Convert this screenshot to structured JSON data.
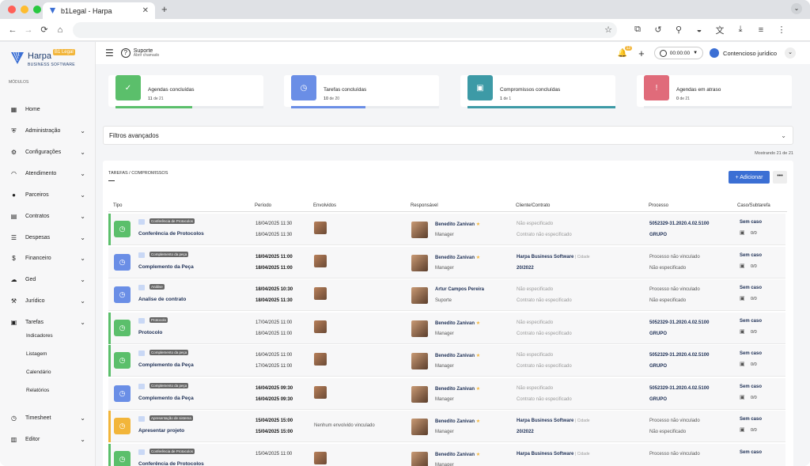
{
  "browser": {
    "tab_title": "b1Legal - Harpa",
    "tab_close": "✕",
    "new_tab": "+",
    "nav_back": "←",
    "nav_forward": "→",
    "nav_reload": "⟳",
    "nav_home": "⌂",
    "bookmark": "☆",
    "menu": "⋮"
  },
  "app": {
    "logo_name": "Harpa",
    "logo_badge": "B1 Legal",
    "logo_tagline": "BUSINESS SOFTWARE",
    "modules_label": "MÓDULOS"
  },
  "sidebar": {
    "items": [
      {
        "label": "Home",
        "icon": "grid-icon",
        "chev": ""
      },
      {
        "label": "Administração",
        "icon": "shield-icon",
        "chev": "⌄"
      },
      {
        "label": "Configurações",
        "icon": "gear-icon",
        "chev": "⌄"
      },
      {
        "label": "Atendimento",
        "icon": "headset-icon",
        "chev": "⌄"
      },
      {
        "label": "Parceiros",
        "icon": "user-icon",
        "chev": "⌄"
      },
      {
        "label": "Contratos",
        "icon": "document-icon",
        "chev": "⌄"
      },
      {
        "label": "Despesas",
        "icon": "list-icon",
        "chev": "⌄"
      },
      {
        "label": "Financeiro",
        "icon": "dollar-icon",
        "chev": "⌄"
      },
      {
        "label": "Ged",
        "icon": "cloud-icon",
        "chev": "⌄"
      },
      {
        "label": "Jurídico",
        "icon": "gavel-icon",
        "chev": "⌄"
      },
      {
        "label": "Tarefas",
        "icon": "calendar-icon",
        "chev": "⌄"
      },
      {
        "label": "Timesheet",
        "icon": "clock-icon",
        "chev": "⌄"
      },
      {
        "label": "Editor",
        "icon": "file-icon",
        "chev": "⌄"
      }
    ],
    "subitems": [
      "Indicadores",
      "Listagem",
      "Calendário",
      "Relatórios"
    ]
  },
  "header": {
    "support_title": "Suporte",
    "support_sub": "Abrir chamado",
    "notif_count": "12",
    "timer": "00:00:00",
    "user": "Contencioso jurídico"
  },
  "cards": [
    {
      "title": "Agendas concluídas",
      "done": "11",
      "of": "de 21",
      "color": "#5bbf6b",
      "fill": 0.52
    },
    {
      "title": "Tarefas concluídas",
      "done": "10",
      "of": "de 20",
      "color": "#6a8ee6",
      "fill": 0.5
    },
    {
      "title": "Compromissos concluídas",
      "done": "1",
      "of": "de 1",
      "color": "#3d9aa6",
      "fill": 1.0
    },
    {
      "title": "Agendas em atraso",
      "done": "0",
      "of": "de 21",
      "color": "#e06b7a",
      "fill": 0.0
    }
  ],
  "filters": {
    "label": "Filtros avançados"
  },
  "showing": "Mostrando 21 de 21",
  "table": {
    "title": "TAREFAS / COMPROMISSOS",
    "add_label": "+  Adicionar",
    "more_label": "•••",
    "columns": [
      "Tipo",
      "Período",
      "Envolvidos",
      "Responsável",
      "Cliente/Contrato",
      "Processo",
      "Caso/Subtarefa"
    ],
    "rows": [
      {
        "stripe": "#5bbf6b",
        "icon_color": "#5bbf6b",
        "tag": "Conferência de Protocolos",
        "title": "Conferência de Protocolos",
        "p1": "18/04/2025 11:30",
        "p2": "18/04/2025 11:30",
        "pbold": false,
        "env": "avatar",
        "resp": "Benedito Zanivan",
        "star": true,
        "role": "Manager",
        "c1": "Não especificado",
        "c2": "Contrato não especificado",
        "cstyle": "m",
        "c1sub": "",
        "pr1": "5052329-31.2020.4.02.5100",
        "pr2": "GRUPO",
        "prstyle": "s",
        "case": "Sem caso",
        "count": "0/0"
      },
      {
        "stripe": "",
        "icon_color": "#6a8ee6",
        "tag": "Complemento da peça",
        "title": "Complemento da Peça",
        "p1": "18/04/2025 11:00",
        "p2": "18/04/2025 11:00",
        "pbold": true,
        "env": "avatar",
        "resp": "Benedito Zanivan",
        "star": true,
        "role": "Manager",
        "c1": "Harpa Business Software",
        "c2": "20/2022",
        "cstyle": "s",
        "c1sub": "| Cidade",
        "pr1": "Processo não vinculado",
        "pr2": "Não especificado",
        "prstyle": "m",
        "case": "Sem caso",
        "count": "0/0"
      },
      {
        "stripe": "",
        "icon_color": "#6a8ee6",
        "tag": "Análise",
        "title": "Analise de contrato",
        "p1": "18/04/2025 10:30",
        "p2": "18/04/2025 11:30",
        "pbold": true,
        "env": "avatar",
        "resp": "Artur Campos Pereira",
        "star": false,
        "role": "Suporte",
        "c1": "Não especificado",
        "c2": "Contrato não especificado",
        "cstyle": "m",
        "c1sub": "",
        "pr1": "Processo não vinculado",
        "pr2": "Não especificado",
        "prstyle": "m",
        "case": "Sem caso",
        "count": "0/0"
      },
      {
        "stripe": "#5bbf6b",
        "icon_color": "#5bbf6b",
        "tag": "Protocolo",
        "title": "Protocolo",
        "p1": "17/04/2025 11:00",
        "p2": "18/04/2025 11:00",
        "pbold": false,
        "env": "avatar",
        "resp": "Benedito Zanivan",
        "star": true,
        "role": "Manager",
        "c1": "Não especificado",
        "c2": "Contrato não especificado",
        "cstyle": "m",
        "c1sub": "",
        "pr1": "5052329-31.2020.4.02.5100",
        "pr2": "GRUPO",
        "prstyle": "s",
        "case": "Sem caso",
        "count": "0/0"
      },
      {
        "stripe": "#5bbf6b",
        "icon_color": "#5bbf6b",
        "tag": "Complemento da peça",
        "title": "Complemento da Peça",
        "p1": "16/04/2025 11:00",
        "p2": "17/04/2025 11:00",
        "pbold": false,
        "env": "avatar",
        "resp": "Benedito Zanivan",
        "star": true,
        "role": "Manager",
        "c1": "Não especificado",
        "c2": "Contrato não especificado",
        "cstyle": "m",
        "c1sub": "",
        "pr1": "5052329-31.2020.4.02.5100",
        "pr2": "GRUPO",
        "prstyle": "s",
        "case": "Sem caso",
        "count": "0/0"
      },
      {
        "stripe": "",
        "icon_color": "#6a8ee6",
        "tag": "Complemento da peça",
        "title": "Complemento da Peça",
        "p1": "16/04/2025 09:30",
        "p2": "16/04/2025 09:30",
        "pbold": true,
        "env": "avatar",
        "resp": "Benedito Zanivan",
        "star": true,
        "role": "Manager",
        "c1": "Não especificado",
        "c2": "Contrato não especificado",
        "cstyle": "m",
        "c1sub": "",
        "pr1": "5052329-31.2020.4.02.5100",
        "pr2": "GRUPO",
        "prstyle": "s",
        "case": "Sem caso",
        "count": "0/0"
      },
      {
        "stripe": "#f2b53a",
        "icon_color": "#f2b53a",
        "tag": "Apresentação de sistema",
        "title": "Apresentar projeto",
        "p1": "15/04/2025 15:00",
        "p2": "15/04/2025 15:00",
        "pbold": true,
        "env": "text",
        "envtext": "Nenhum envolvido vinculado",
        "resp": "Benedito Zanivan",
        "star": true,
        "role": "Manager",
        "c1": "Harpa Business Software",
        "c2": "20/2022",
        "cstyle": "s",
        "c1sub": "| Cidade",
        "pr1": "Processo não vinculado",
        "pr2": "Não especificado",
        "prstyle": "m",
        "case": "Sem caso",
        "count": "0/0"
      },
      {
        "stripe": "#5bbf6b",
        "icon_color": "#5bbf6b",
        "tag": "Conferência de Protocolos",
        "title": "Conferência de Protocolos",
        "p1": "15/04/2025 11:00",
        "p2": "",
        "pbold": false,
        "env": "avatar",
        "resp": "Benedito Zanivan",
        "star": true,
        "role": "Manager",
        "c1": "Harpa Business Software",
        "c2": "",
        "cstyle": "s",
        "c1sub": "| Cidade",
        "pr1": "Processo não vinculado",
        "pr2": "",
        "prstyle": "m",
        "case": "Sem caso",
        "count": ""
      }
    ]
  }
}
